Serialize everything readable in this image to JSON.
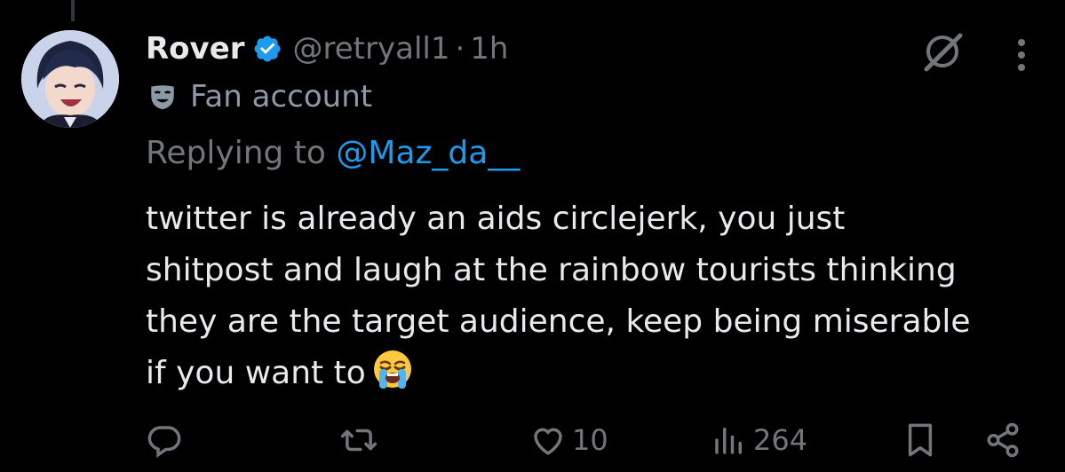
{
  "tweet": {
    "display_name": "Rover",
    "handle": "@retryall1",
    "separator": "·",
    "time": "1h",
    "label": "Fan account",
    "reply_prefix": "Replying to ",
    "reply_mention": "@Maz_da__",
    "text_lines": [
      "twitter is already an aids circlejerk, you just",
      "shitpost and laugh at the rainbow tourists thinking",
      "they are the target audience, keep being miserable",
      "if you want to"
    ],
    "emoji": "loudly-crying-face"
  },
  "actions": {
    "reply_count": "",
    "retweet_count": "",
    "like_count": "10",
    "views_count": "264"
  },
  "colors": {
    "background": "#000000",
    "text": "#e7e9ea",
    "muted": "#71767b",
    "link": "#1d9bf0",
    "verified": "#1d9bf0"
  },
  "icons": [
    "verified-badge-icon",
    "grok-icon",
    "more-icon",
    "mask-icon",
    "reply-icon",
    "retweet-icon",
    "like-icon",
    "views-icon",
    "bookmark-icon",
    "share-icon",
    "crying-emoji-icon"
  ]
}
